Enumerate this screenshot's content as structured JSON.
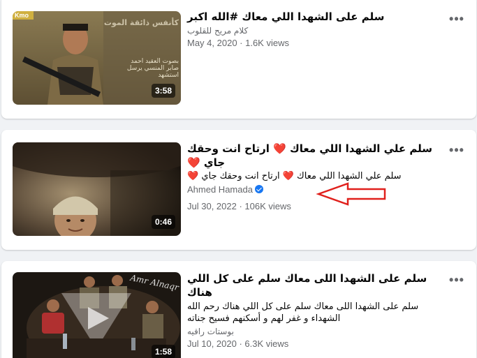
{
  "videos": [
    {
      "title": "سلم على الشهدا اللي معاك #الله اكبر",
      "description": "",
      "channel": "كلام مريح للقلوب",
      "verified": false,
      "date": "May 4, 2020",
      "views": "1.6K views",
      "separator": " · ",
      "duration": "3:58",
      "thumb_overlay_text": [
        "كأنفس ذائقة الموت",
        "بصوت العقيد احمد",
        "صابر المنسي يرسل",
        "استشهد"
      ],
      "thumb_logo": "Kmo"
    },
    {
      "title": "سلم علي الشهدا اللي معاك ❤️ ارتاح انت وحقك جاي ❤️",
      "description": "سلم علي الشهدا اللي معاك ❤️ ارتاح انت وحقك جاي ❤️",
      "channel": "Ahmed Hamada",
      "verified": true,
      "date": "Jul 30, 2022",
      "views": "106K views",
      "separator": " · ",
      "duration": "0:46"
    },
    {
      "title": "سلم على الشهدا اللى معاك سلم على كل اللي هناك",
      "description": "سلم على الشهدا اللى معاك سلم على كل اللي هناك رحم الله الشهداء و غفر لهم و أسكنهم فسيح جناته",
      "channel": "بوستات راقيه",
      "verified": false,
      "date": "Jul 10, 2020",
      "views": "6.3K views",
      "separator": " · ",
      "duration": "1:58",
      "thumb_watermark": "Amr Alnaqr"
    }
  ],
  "more_label": "•••",
  "colors": {
    "accent": "#1877f2",
    "arrow": "#e0201c",
    "background": "#f0f2f5"
  }
}
